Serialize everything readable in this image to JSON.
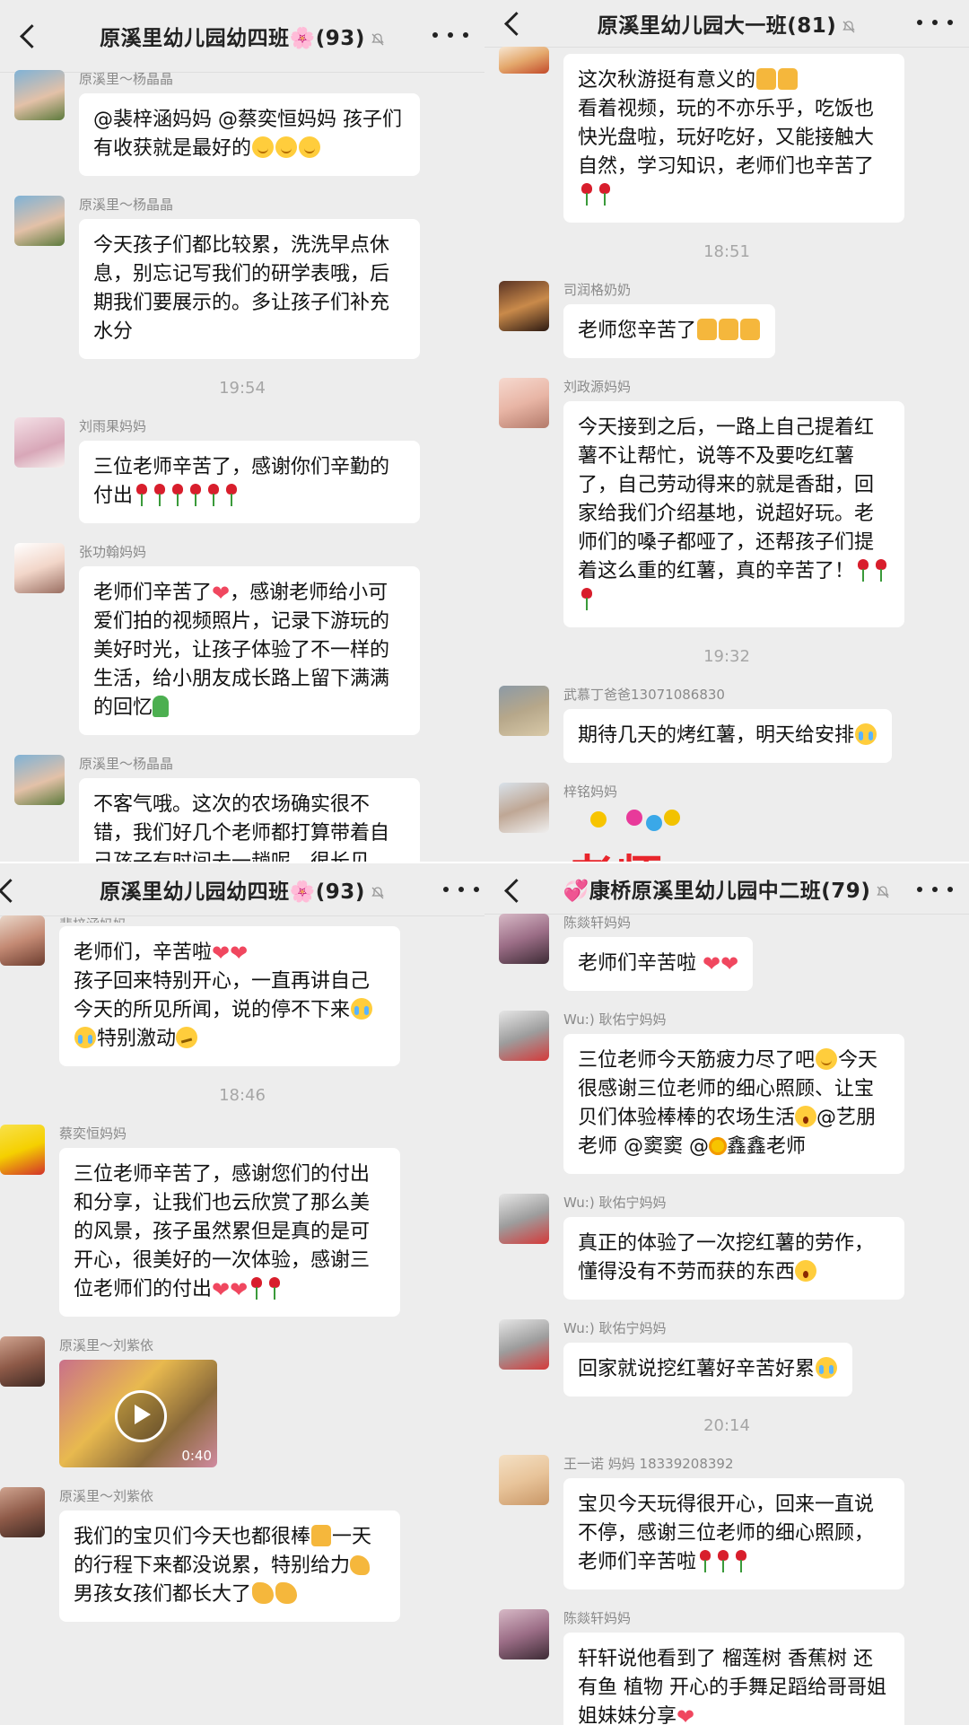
{
  "tl": {
    "title": "原溪里幼儿园幼四班🌸(93)",
    "messages": [
      {
        "sender": "原溪里～杨晶晶",
        "text": "@裴梓涵妈妈 @蔡奕恒妈妈 孩子们有收获就是最好的"
      },
      {
        "sender": "原溪里～杨晶晶",
        "text": "今天孩子们都比较累，洗洗早点休息，别忘记写我们的研学表哦，后期我们要展示的。多让孩子们补充水分"
      },
      {
        "time": "19:54"
      },
      {
        "sender": "刘雨果妈妈",
        "text": "三位老师辛苦了，感谢你们辛勤的付出"
      },
      {
        "sender": "张功翰妈妈",
        "text_a": "老师们辛苦了",
        "text_b": "，感谢老师给小可爱们拍的视频照片，记录下游玩的美好时光，让孩子体验了不一样的生活，给小朋友成长路上留下满满的回忆"
      },
      {
        "sender": "原溪里～杨晶晶",
        "text": "不客气哦。这次的农场确实很不错，我们好几个老师都打算带着自己孩子有时间去一趟呢，很长见识。"
      }
    ]
  },
  "tr": {
    "title": "原溪里幼儿园大一班(81)",
    "messages": [
      {
        "text_a": "这次秋游挺有意义的",
        "text_b": "看着视频，玩的不亦乐乎，吃饭也快光盘啦，玩好吃好，又能接触大自然，学习知识，老师们也辛苦了"
      },
      {
        "time": "18:51"
      },
      {
        "sender": "司润格奶奶",
        "text": "老师您辛苦了"
      },
      {
        "sender": "刘政源妈妈",
        "text": "今天接到之后，一路上自己提着红薯不让帮忙，说等不及要吃红薯了，自己劳动得来的就是香甜，回家给我们介绍基地，说超好玩。老师们的嗓子都哑了，还帮孩子们提着这么重的红薯，真的辛苦了！"
      },
      {
        "time": "19:32"
      },
      {
        "sender": "武慕丁爸爸13071086830",
        "text": "期待几天的烤红薯，明天给安排"
      },
      {
        "sender": "梓铭妈妈",
        "sticker": "老师"
      }
    ]
  },
  "bl": {
    "title": "原溪里幼儿园幼四班🌸(93)",
    "messages": [
      {
        "sender": "裴梓涵妈妈",
        "text_a": "老师们，辛苦啦",
        "text_b": "孩子回来特别开心，一直再讲自己今天的所见所闻，说的停不下来",
        "text_c": "特别激动"
      },
      {
        "time": "18:46"
      },
      {
        "sender": "蔡奕恒妈妈",
        "text": "三位老师辛苦了，感谢您们的付出和分享，让我们也云欣赏了那么美的风景，孩子虽然累但是真的是可开心，很美好的一次体验，感谢三位老师们的付出"
      },
      {
        "sender": "原溪里～刘紫依",
        "video_duration": "0:40"
      },
      {
        "sender": "原溪里～刘紫依",
        "text_a": "我们的宝贝们今天也都很棒",
        "text_b": "一天的行程下来都没说累，特别给力",
        "text_c": "男孩女孩们都长大了"
      }
    ]
  },
  "br": {
    "title": "💞康桥原溪里幼儿园中二班(79)",
    "messages": [
      {
        "sender": "陈燚轩妈妈",
        "text": "老师们辛苦啦"
      },
      {
        "sender": "Wu:) 耿佑宁妈妈",
        "text_a": "三位老师今天筋疲力尽了吧",
        "text_b": "今天很感谢三位老师的细心照顾、让宝贝们体验棒棒的农场生活",
        "text_c": "@艺朋老师 @窦窦 @",
        "text_d": "鑫鑫老师"
      },
      {
        "sender": "Wu:) 耿佑宁妈妈",
        "text": "真正的体验了一次挖红薯的劳作，懂得没有不劳而获的东西"
      },
      {
        "sender": "Wu:) 耿佑宁妈妈",
        "text": "回家就说挖红薯好辛苦好累"
      },
      {
        "time": "20:14"
      },
      {
        "sender": "王一诺 妈妈 18339208392",
        "text": "宝贝今天玩得很开心，回来一直说不停，感谢三位老师的细心照顾，老师们辛苦啦"
      },
      {
        "sender": "陈燚轩妈妈",
        "text": "轩轩说他看到了 榴莲树 香蕉树 还有鱼 植物 开心的手舞足蹈给哥哥姐姐妹妹分享"
      }
    ]
  }
}
